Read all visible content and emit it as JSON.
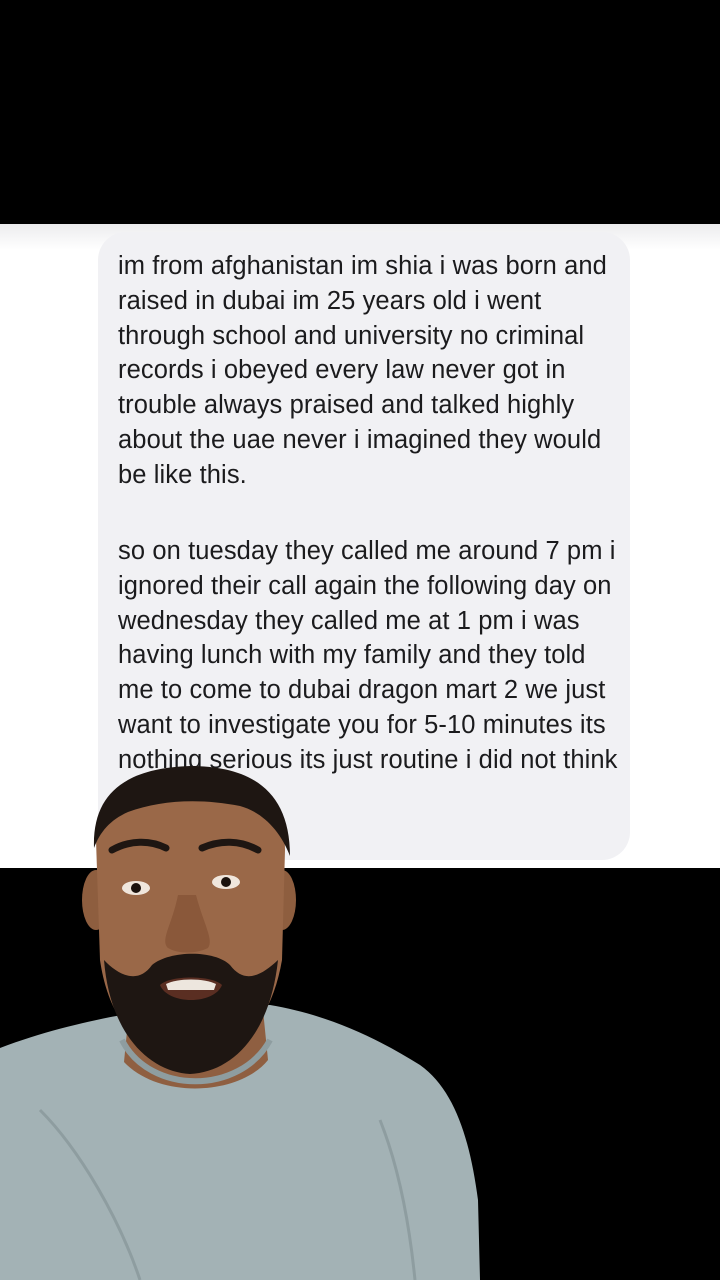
{
  "message": {
    "paragraphs": [
      "im from afghanistan im shia i was born and raised in dubai im 25 years old i went through school and university no criminal records i obeyed every law never got in trouble always praised and talked highly about the uae never i imagined they would be like this.",
      "so on tuesday they called me around 7 pm i ignored their call again the following day on wednesday they called me at 1 pm i was having lunch with my family and they told me to come to dubai dragon mart 2 we just want to investigate you for 5-10 minutes its nothing serious its just routine i did not think anything of it"
    ]
  },
  "colors": {
    "background": "#000000",
    "panel": "#ffffff",
    "bubble": "#f1f1f4",
    "text": "#1b1b1d",
    "shirt": "#a3b2b5",
    "skin": "#9a6848"
  },
  "icons": {
    "presenter": "person-speaking-figure"
  }
}
